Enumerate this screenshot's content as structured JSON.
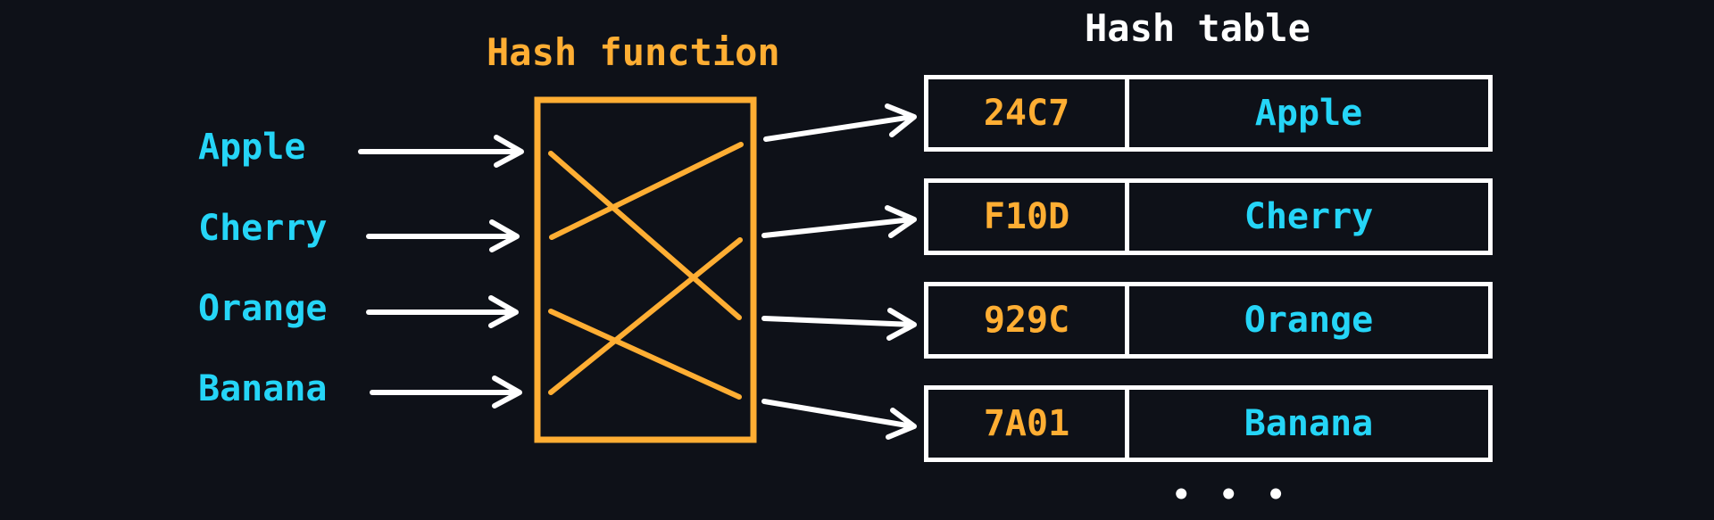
{
  "colors": {
    "background": "#0e1118",
    "key_text": "#25d5f7",
    "hash_text": "#ffae33",
    "hash_function_box": "#ffae33",
    "table_border": "#ffffff",
    "arrows": "#ffffff"
  },
  "hash_function": {
    "title": "Hash function",
    "mapping_note": "input position -> output position",
    "mappings": [
      {
        "from": "Apple",
        "to_row": 2
      },
      {
        "from": "Cherry",
        "to_row": 0
      },
      {
        "from": "Orange",
        "to_row": 3
      },
      {
        "from": "Banana",
        "to_row": 1
      }
    ]
  },
  "inputs": {
    "keys": [
      "Apple",
      "Cherry",
      "Orange",
      "Banana"
    ]
  },
  "hash_table": {
    "title": "Hash table",
    "rows": [
      {
        "hash": "24C7",
        "value": "Apple"
      },
      {
        "hash": "F10D",
        "value": "Cherry"
      },
      {
        "hash": "929C",
        "value": "Orange"
      },
      {
        "hash": "7A01",
        "value": "Banana"
      }
    ],
    "continuation": "• • •"
  }
}
